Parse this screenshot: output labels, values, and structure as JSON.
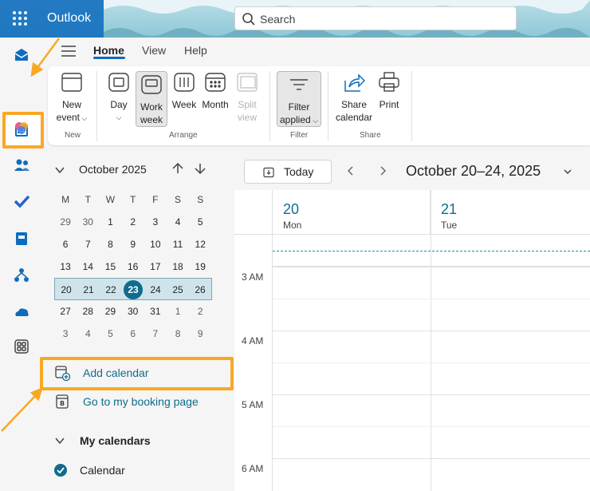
{
  "app": {
    "name": "Outlook"
  },
  "search": {
    "placeholder": "Search"
  },
  "tabs": [
    {
      "label": "Home",
      "active": true
    },
    {
      "label": "View",
      "active": false
    },
    {
      "label": "Help",
      "active": false
    }
  ],
  "ribbon": {
    "new_event": {
      "line1": "New",
      "line2": "event"
    },
    "day": "Day",
    "work_week": {
      "line1": "Work",
      "line2": "week"
    },
    "week": "Week",
    "month": "Month",
    "split_view": {
      "line1": "Split",
      "line2": "view"
    },
    "filter": {
      "line1": "Filter",
      "line2": "applied"
    },
    "share_calendar": {
      "line1": "Share",
      "line2": "calendar"
    },
    "print": "Print",
    "groups": {
      "new": "New",
      "arrange": "Arrange",
      "filter": "Filter",
      "share": "Share"
    }
  },
  "mini_calendar": {
    "month_label": "October 2025",
    "weekday_headers": [
      "M",
      "T",
      "W",
      "T",
      "F",
      "S",
      "S"
    ],
    "weeks": [
      [
        {
          "d": "29",
          "dim": true
        },
        {
          "d": "30",
          "dim": true
        },
        {
          "d": "1"
        },
        {
          "d": "2"
        },
        {
          "d": "3"
        },
        {
          "d": "4"
        },
        {
          "d": "5"
        }
      ],
      [
        {
          "d": "6"
        },
        {
          "d": "7"
        },
        {
          "d": "8"
        },
        {
          "d": "9"
        },
        {
          "d": "10"
        },
        {
          "d": "11"
        },
        {
          "d": "12"
        }
      ],
      [
        {
          "d": "13"
        },
        {
          "d": "14"
        },
        {
          "d": "15"
        },
        {
          "d": "16"
        },
        {
          "d": "17"
        },
        {
          "d": "18"
        },
        {
          "d": "19"
        }
      ],
      [
        {
          "d": "20"
        },
        {
          "d": "21"
        },
        {
          "d": "22"
        },
        {
          "d": "23",
          "today": true
        },
        {
          "d": "24"
        },
        {
          "d": "25"
        },
        {
          "d": "26"
        }
      ],
      [
        {
          "d": "27"
        },
        {
          "d": "28"
        },
        {
          "d": "29"
        },
        {
          "d": "30"
        },
        {
          "d": "31"
        },
        {
          "d": "1",
          "dim": true
        },
        {
          "d": "2",
          "dim": true
        }
      ],
      [
        {
          "d": "3",
          "dim": true
        },
        {
          "d": "4",
          "dim": true
        },
        {
          "d": "5",
          "dim": true
        },
        {
          "d": "6",
          "dim": true
        },
        {
          "d": "7",
          "dim": true
        },
        {
          "d": "8",
          "dim": true
        },
        {
          "d": "9",
          "dim": true
        }
      ]
    ],
    "selected_week_index": 3
  },
  "left_links": {
    "add_calendar": "Add calendar",
    "booking_page": "Go to my booking page"
  },
  "my_calendars": {
    "title": "My calendars",
    "items": [
      {
        "label": "Calendar",
        "checked": true
      }
    ]
  },
  "main": {
    "today_label": "Today",
    "range_title": "October 20–24, 2025",
    "days": [
      {
        "num": "20",
        "name": "Mon"
      },
      {
        "num": "21",
        "name": "Tue"
      }
    ],
    "hours": [
      "3 AM",
      "4 AM",
      "5 AM",
      "6 AM"
    ]
  },
  "colors": {
    "accent": "#0f6c8c",
    "brand": "#0f6cbd",
    "highlight": "#f9a825"
  }
}
